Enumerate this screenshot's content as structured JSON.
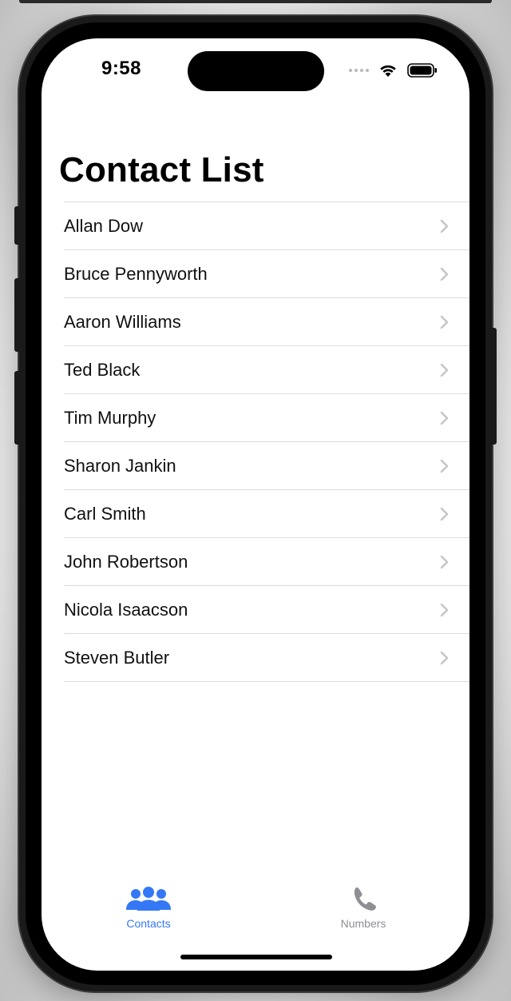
{
  "status_bar": {
    "time": "9:58"
  },
  "page": {
    "title": "Contact List"
  },
  "contacts": [
    {
      "name": "Allan Dow"
    },
    {
      "name": "Bruce Pennyworth"
    },
    {
      "name": "Aaron Williams"
    },
    {
      "name": "Ted Black"
    },
    {
      "name": "Tim Murphy"
    },
    {
      "name": "Sharon Jankin"
    },
    {
      "name": "Carl Smith"
    },
    {
      "name": "John Robertson"
    },
    {
      "name": "Nicola Isaacson"
    },
    {
      "name": "Steven Butler"
    }
  ],
  "tab_bar": {
    "tabs": [
      {
        "label": "Contacts",
        "icon": "people-icon",
        "selected": true
      },
      {
        "label": "Numbers",
        "icon": "phone-icon",
        "selected": false
      }
    ]
  },
  "colors": {
    "accent": "#3478f6",
    "inactive": "#8e8e93",
    "separator": "#dcdcdc",
    "chevron": "#c4c4c7"
  }
}
